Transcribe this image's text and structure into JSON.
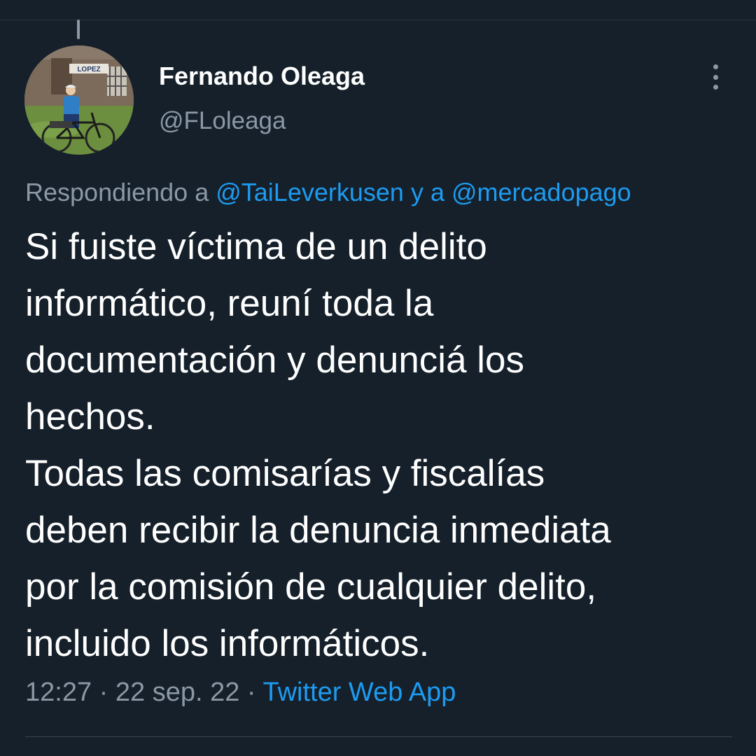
{
  "tweet": {
    "author": {
      "display_name": "Fernando Oleaga",
      "handle": "@FLoleaga",
      "avatar_sign_text": "LOPEZ"
    },
    "replying": {
      "prefix": "Respondiendo a",
      "mention_1": "@TaiLeverkusen",
      "joiner": "y a",
      "mention_2": "@mercadopago"
    },
    "text_lines": [
      "Si fuiste víctima de un delito",
      "informático, reuní toda la",
      "documentación y denunciá los",
      "hechos.",
      "Todas las comisarías y fiscalías",
      "deben recibir la denuncia inmediata",
      "por la comisión de cualquier delito,",
      "incluido los informáticos."
    ],
    "time": "12:27",
    "separator": "·",
    "date": "22 sep. 22",
    "source": "Twitter Web App",
    "more_icon": "more-vertical-icon"
  },
  "colors": {
    "background": "#15202b",
    "primary_text": "#ffffff",
    "secondary_text": "#8b98a5",
    "link": "#1d9bf0",
    "divider": "#38444d"
  }
}
